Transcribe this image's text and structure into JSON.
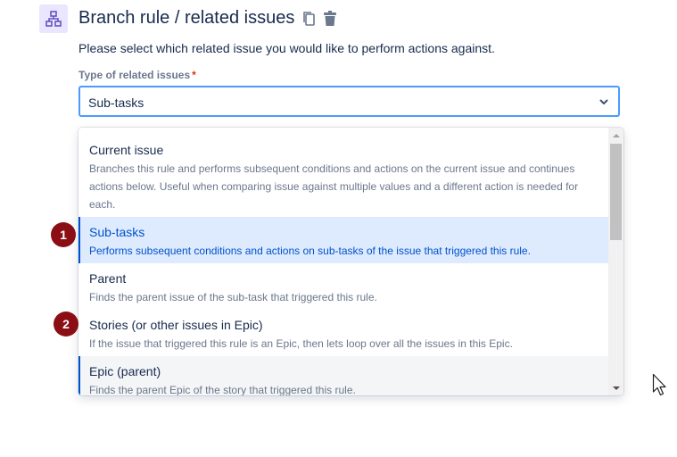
{
  "header": {
    "title": "Branch rule / related issues",
    "icons": [
      "branch-icon",
      "copy-icon",
      "trash-icon"
    ]
  },
  "instruction": "Please select which related issue you would like to perform actions against.",
  "field": {
    "label": "Type of related issues",
    "required_marker": "*",
    "selected_value": "Sub-tasks"
  },
  "options": [
    {
      "title": "Current issue",
      "description": "Branches this rule and performs subsequent conditions and actions on the current issue and continues actions below. Useful when comparing issue against multiple values and a different action is needed for each."
    },
    {
      "title": "Sub-tasks",
      "description": "Performs subsequent conditions and actions on sub-tasks of the issue that triggered this rule."
    },
    {
      "title": "Parent",
      "description": "Finds the parent issue of the sub-task that triggered this rule."
    },
    {
      "title": "Stories (or other issues in Epic)",
      "description": "If the issue that triggered this rule is an Epic, then lets loop over all the issues in this Epic."
    },
    {
      "title": "Epic (parent)",
      "description": "Finds the parent Epic of the story that triggered this rule."
    }
  ],
  "annotations": [
    "1",
    "2"
  ],
  "colors": {
    "selected_bg": "#deebff",
    "accent": "#0052cc",
    "badge": "#8b0e14",
    "focus_border": "#4c9aff"
  }
}
